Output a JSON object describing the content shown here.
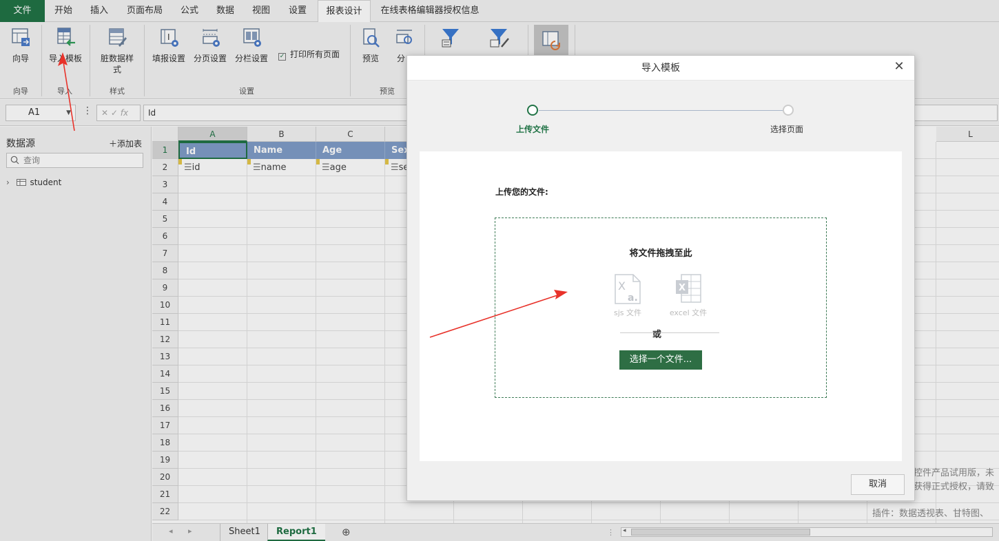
{
  "menu": {
    "tabs": [
      "文件",
      "开始",
      "插入",
      "页面布局",
      "公式",
      "数据",
      "视图",
      "设置",
      "报表设计",
      "在线表格编辑器授权信息"
    ],
    "active_index": 8
  },
  "ribbon": {
    "wizard": "向导",
    "import_template": "导入模板",
    "dirty_style_1": "脏数据样",
    "dirty_style_2": "式",
    "fill_settings": "填报设置",
    "page_settings": "分页设置",
    "column_settings": "分栏设置",
    "print_all": "打印所有页面",
    "preview": "预览",
    "partial": "分",
    "groups": {
      "wizard": "向导",
      "import": "导入",
      "style": "样式",
      "settings": "设置",
      "preview": "预览"
    }
  },
  "formula": {
    "cell_ref": "A1",
    "fx": "fx",
    "value": "Id"
  },
  "datasource": {
    "title": "数据源",
    "add_table": "添加表",
    "search_placeholder": "查询",
    "tables": [
      "student"
    ]
  },
  "grid": {
    "columns": [
      "A",
      "B",
      "C",
      "L"
    ],
    "rows": [
      "1",
      "2",
      "3",
      "4",
      "5",
      "6",
      "7",
      "8",
      "9",
      "10",
      "11",
      "12",
      "13",
      "14",
      "15",
      "16",
      "17",
      "18",
      "19",
      "20",
      "21",
      "22"
    ],
    "header_cells": [
      "Id",
      "Name",
      "Age",
      "Sex"
    ],
    "field_cells": [
      "id",
      "name",
      "age",
      "se"
    ]
  },
  "sheets": {
    "tabs": [
      "Sheet1",
      "Report1"
    ],
    "active_index": 1
  },
  "watermark": {
    "line1": "控件产品试用版，未",
    "line2": "获得正式授权，请致",
    "line3": "插件：数据透视表、甘特图、"
  },
  "dialog": {
    "title": "导入模板",
    "steps": [
      "上传文件",
      "选择页面"
    ],
    "upload_title": "上传您的文件:",
    "drop_text": "将文件拖拽至此",
    "sjs_label": "sjs 文件",
    "excel_label": "excel 文件",
    "or_text": "或",
    "choose_button": "选择一个文件...",
    "cancel_button": "取消"
  },
  "colors": {
    "accent": "#217346",
    "header_fill": "#7f9dc8",
    "arrow": "#e8322a"
  }
}
